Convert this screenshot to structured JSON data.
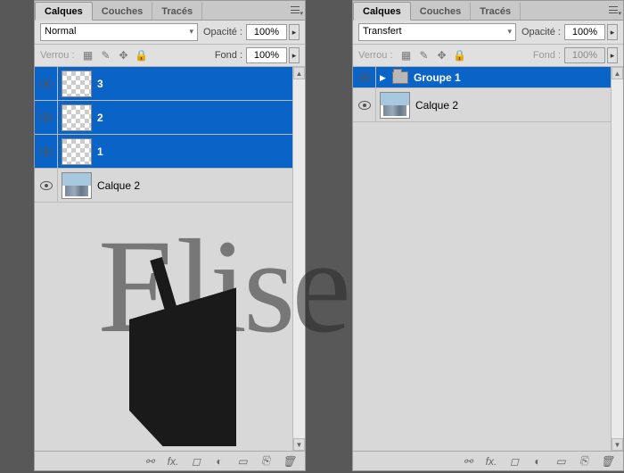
{
  "left_panel": {
    "tabs": {
      "layers": "Calques",
      "channels": "Couches",
      "paths": "Tracés"
    },
    "blend_mode": "Normal",
    "opacity_label": "Opacité :",
    "opacity_value": "100%",
    "lock_label": "Verrou :",
    "fill_label": "Fond :",
    "fill_value": "100%",
    "layers": [
      {
        "name": "3",
        "selected": true,
        "kind": "pattern"
      },
      {
        "name": "2",
        "selected": true,
        "kind": "pattern"
      },
      {
        "name": "1",
        "selected": true,
        "kind": "pattern"
      },
      {
        "name": "Calque 2",
        "selected": false,
        "kind": "image"
      }
    ]
  },
  "right_panel": {
    "tabs": {
      "layers": "Calques",
      "channels": "Couches",
      "paths": "Tracés"
    },
    "blend_mode": "Transfert",
    "opacity_label": "Opacité :",
    "opacity_value": "100%",
    "lock_label": "Verrou :",
    "fill_label": "Fond :",
    "fill_value": "100%",
    "layers": [
      {
        "name": "Groupe 1",
        "selected": true,
        "kind": "group"
      },
      {
        "name": "Calque 2",
        "selected": false,
        "kind": "image"
      }
    ]
  },
  "watermark": "Elise"
}
